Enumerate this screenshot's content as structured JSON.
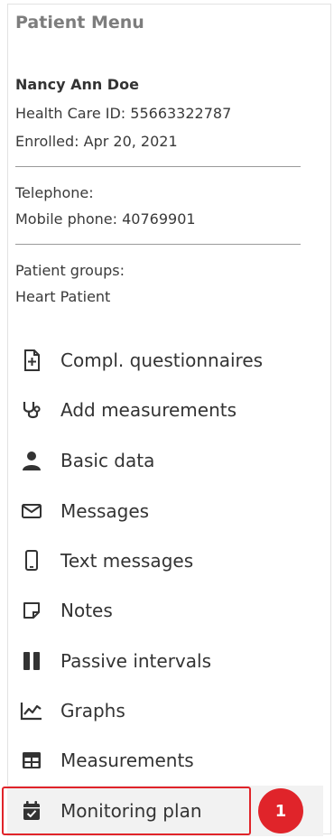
{
  "menu": {
    "title": "Patient Menu"
  },
  "patient": {
    "name": "Nancy Ann Doe",
    "health_care_id": "Health Care ID: 55663322787",
    "enrolled": "Enrolled: Apr 20, 2021",
    "telephone": "Telephone:",
    "mobile_phone": "Mobile phone: 40769901",
    "groups_label": "Patient groups:",
    "groups_value": "Heart Patient"
  },
  "nav": {
    "items": [
      {
        "label": "Compl. questionnaires",
        "icon": "document-plus-icon"
      },
      {
        "label": "Add measurements",
        "icon": "stethoscope-icon"
      },
      {
        "label": "Basic data",
        "icon": "person-icon"
      },
      {
        "label": "Messages",
        "icon": "envelope-icon"
      },
      {
        "label": "Text messages",
        "icon": "mobile-phone-icon"
      },
      {
        "label": "Notes",
        "icon": "note-icon"
      },
      {
        "label": "Passive intervals",
        "icon": "pause-columns-icon"
      },
      {
        "label": "Graphs",
        "icon": "line-chart-icon"
      },
      {
        "label": "Measurements",
        "icon": "table-icon"
      },
      {
        "label": "Monitoring plan",
        "icon": "calendar-check-icon"
      }
    ]
  },
  "annotation": {
    "badge_number": "1",
    "highlight_color": "#e0242a"
  }
}
